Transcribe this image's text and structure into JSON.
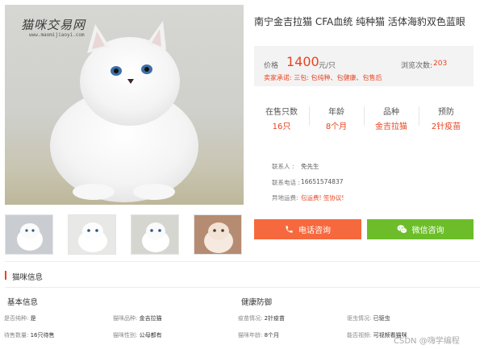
{
  "gallery": {
    "watermark_title": "猫咪交易网",
    "watermark_url": "www.maomijiaoyi.com",
    "thumbnails": [
      "thumb-1",
      "thumb-2",
      "thumb-3",
      "thumb-4"
    ]
  },
  "listing": {
    "title": "南宁金吉拉猫 CFA血统 纯种猫 活体海豹双色蓝眼",
    "price_label": "价格",
    "price": "1400",
    "price_unit": "元/只",
    "views_label": "浏览次数:",
    "views": "203",
    "promise": "卖家承诺: 三包: 包纯种、包健康、包售后"
  },
  "stats": [
    {
      "key": "在售只数",
      "value": "16只"
    },
    {
      "key": "年龄",
      "value": "8个月"
    },
    {
      "key": "品种",
      "value": "金吉拉猫"
    },
    {
      "key": "预防",
      "value": "2针疫苗"
    }
  ],
  "contact": {
    "person_label": "联系人 :",
    "person": "免先生",
    "phone_label": "联系电话 :",
    "phone": "16651574837",
    "shipping_label": "异地运费:",
    "shipping": "包运费! 签协议!"
  },
  "buttons": {
    "phone": "电话咨询",
    "wechat": "微信咨询"
  },
  "section": {
    "title": "猫咪信息",
    "basic_title": "基本信息",
    "health_title": "健康防御",
    "basic": [
      {
        "label": "是否纯种:",
        "value": "是"
      },
      {
        "label": "猫咪品种:",
        "value": "金吉拉猫"
      },
      {
        "label": "待售数量:",
        "value": "16只待售"
      },
      {
        "label": "猫咪性别:",
        "value": "公母都有"
      }
    ],
    "health": [
      {
        "label": "疫苗情况:",
        "value": "2针疫苗"
      },
      {
        "label": "驱虫情况:",
        "value": "已驱虫"
      },
      {
        "label": "猫咪年龄:",
        "value": "8个月"
      },
      {
        "label": "能否视频:",
        "value": "可视频看猫咪"
      }
    ]
  },
  "watermark_footer": "CSDN @嗨学编程",
  "colors": {
    "accent": "#e8431f",
    "phone_button": "#f6693e",
    "wechat_button": "#6dbd2a"
  }
}
